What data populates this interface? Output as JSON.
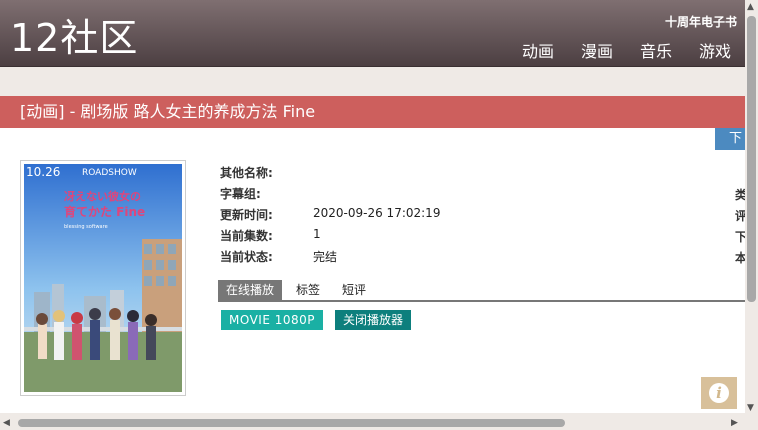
{
  "header": {
    "logo": "12社区",
    "anniversary": "十周年电子书",
    "nav": [
      "动画",
      "漫画",
      "音乐",
      "游戏"
    ]
  },
  "title_bar": "[动画] - 剧场版 路人女主的养成方法 Fine",
  "download_tab": "下",
  "poster": {
    "top_text": "10.26",
    "road": "ROADSHOW",
    "logo_text": "冴えない彼女の育てかた Fine",
    "sub": "blessing software"
  },
  "info": [
    {
      "label": "其他名称:",
      "value": ""
    },
    {
      "label": "字幕组:",
      "value": ""
    },
    {
      "label": "更新时间:",
      "value": "2020-09-26 17:02:19"
    },
    {
      "label": "当前集数:",
      "value": "1"
    },
    {
      "label": "当前状态:",
      "value": "完结"
    }
  ],
  "right_col": [
    "类",
    "评",
    "下",
    "本"
  ],
  "tabs": [
    "在线播放",
    "标签",
    "短评"
  ],
  "buttons": {
    "movie": "MOVIE 1080P",
    "close_player": "关闭播放器"
  },
  "info_icon": "info-icon"
}
